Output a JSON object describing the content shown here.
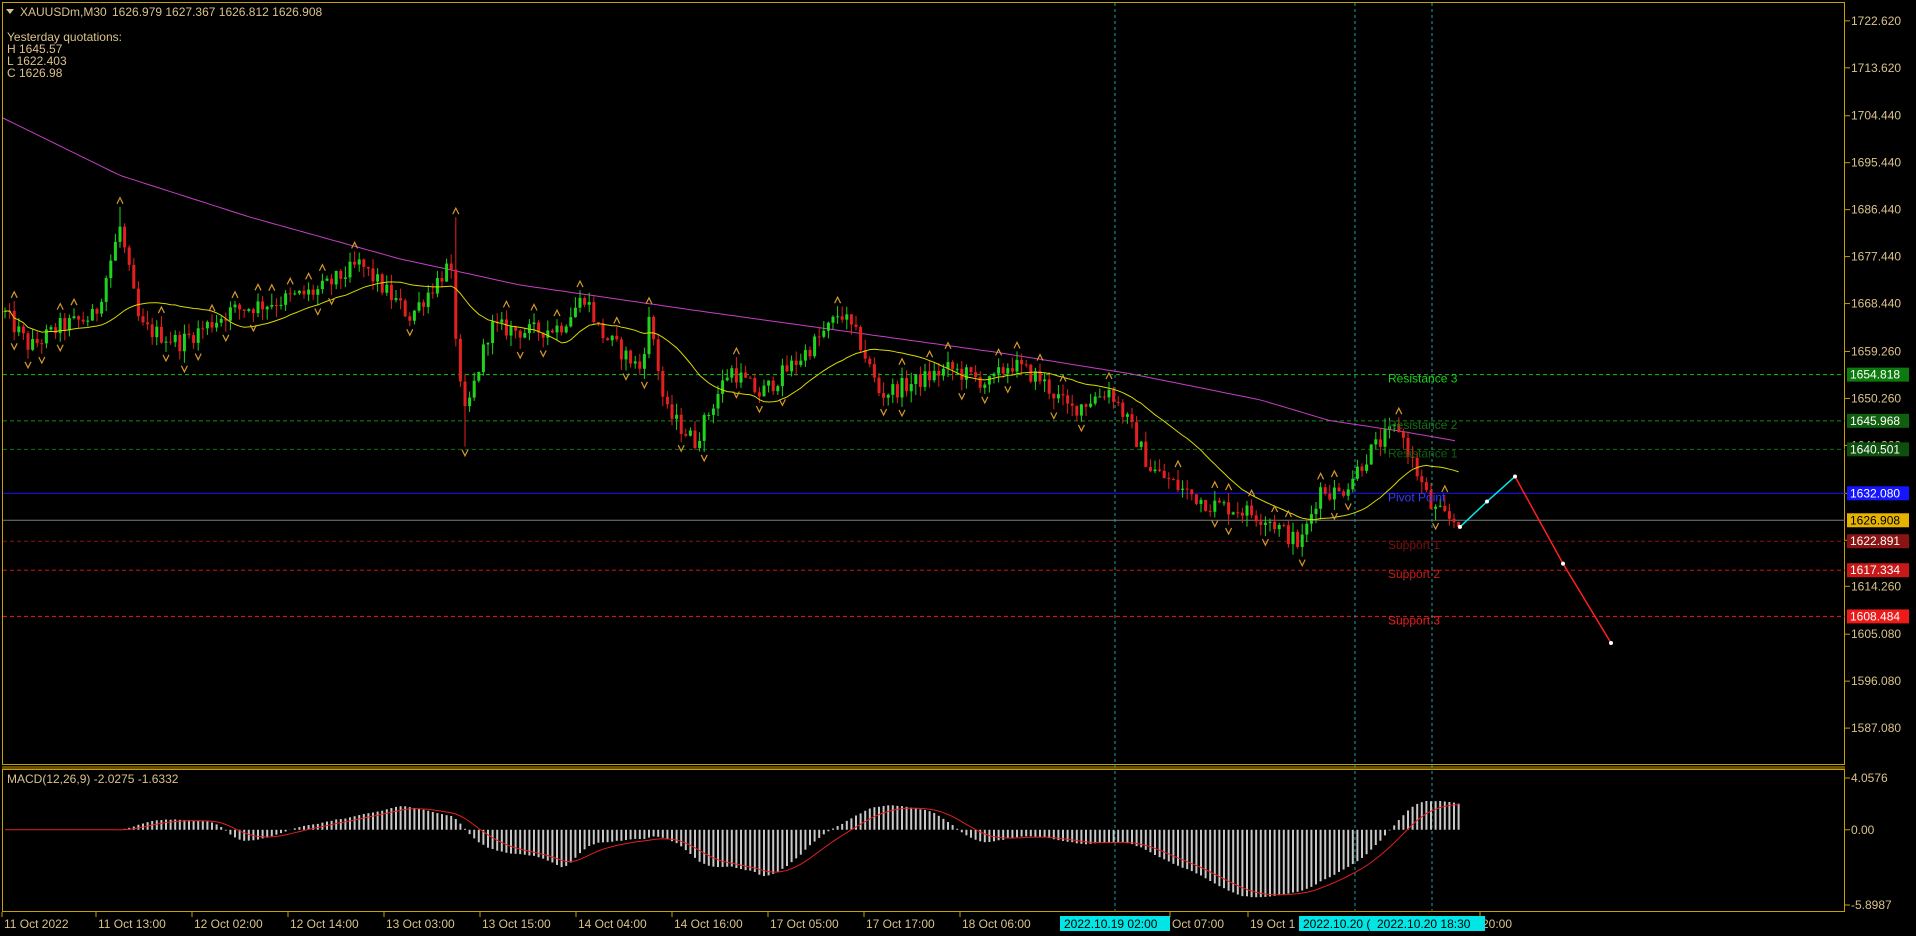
{
  "header": {
    "symbol": "XAUUSDm,M30",
    "ohlc": "1626.979 1627.367 1626.812 1626.908",
    "yesterday_title": "Yesterday quotations:",
    "yesterday_high": "H 1645.57",
    "yesterday_low": "L 1622.403",
    "yesterday_close": "C 1626.98"
  },
  "price_axis": {
    "ticks": [
      "1722.620",
      "1713.620",
      "1704.440",
      "1695.440",
      "1686.440",
      "1677.440",
      "1668.440",
      "1659.260",
      "1650.260",
      "1641.260",
      "1632.080",
      "1623.080",
      "1614.260",
      "1605.080",
      "1596.080",
      "1587.080"
    ],
    "min": 1582.5,
    "max": 1724.7
  },
  "levels": [
    {
      "label": "Resistance 3",
      "badge": "1654.818",
      "price": 1654.818,
      "color": "#12c312",
      "badge_bg": "#0c7a0c",
      "label_color": "#19d219"
    },
    {
      "label": "Resistance 2",
      "badge": "1645.968",
      "price": 1645.968,
      "color": "#1a8a1a",
      "badge_bg": "#0f5f0f",
      "label_color": "#147014"
    },
    {
      "label": "Resistance 1",
      "badge": "1640.501",
      "price": 1640.501,
      "color": "#156d15",
      "badge_bg": "#0e4f0e",
      "label_color": "#0f5f0f"
    },
    {
      "label": "Pivot Point",
      "badge": "1632.080",
      "price": 1632.08,
      "color": "#1515ff",
      "badge_bg": "#1515ff",
      "label_color": "#3838ff"
    },
    {
      "label": "",
      "badge": "1626.908",
      "price": 1626.908,
      "color": "#7b7b7b",
      "badge_bg": "#e6b400",
      "label_color": "#000000"
    },
    {
      "label": "Support 1",
      "badge": "1622.891",
      "price": 1622.891,
      "color": "#8a1414",
      "badge_bg": "#8a1414",
      "label_color": "#7a1010"
    },
    {
      "label": "Support 2",
      "badge": "1617.334",
      "price": 1617.334,
      "color": "#c81818",
      "badge_bg": "#c81818",
      "label_color": "#c81c1c"
    },
    {
      "label": "Support 3",
      "badge": "1608.484",
      "price": 1608.484,
      "color": "#ee1a1a",
      "badge_bg": "#ee1a1a",
      "label_color": "#ee1e1e"
    }
  ],
  "macd": {
    "label": "MACD(12,26,9) -2.0275 -1.6332",
    "ticks": [
      "4.0576",
      "0.00",
      "-5.8987"
    ],
    "min": -5.8987,
    "max": 4.0576
  },
  "time_axis": {
    "labels": [
      "11 Oct 2022",
      "11 Oct 13:00",
      "12 Oct 02:00",
      "12 Oct 14:00",
      "13 Oct 03:00",
      "13 Oct 15:00",
      "14 Oct 04:00",
      "14 Oct 16:00",
      "17 Oct 05:00",
      "17 Oct 17:00",
      "18 Oct 06:00",
      "Oct 07:00",
      "19 Oct 1",
      "20:00"
    ],
    "highlight_1": "2022.10.19 02:00",
    "highlight_2": "2022.10.20 (",
    "highlight_3": "2022.10.20 18:30"
  },
  "colors": {
    "background": "#000000",
    "frame": "#c8a000",
    "text": "#d9c28a",
    "bull": "#1fd31f",
    "bear": "#e31f1f",
    "ma_fast": "#d9d900",
    "ma_slow": "#c53fc5",
    "vline": "#1f9f9f",
    "fractal": "#d49a2a",
    "macd_hist": "#c8c8c8",
    "macd_signal": "#e31f1f",
    "forecast_up": "#00e8e8",
    "forecast_down": "#ff1f1f"
  }
}
